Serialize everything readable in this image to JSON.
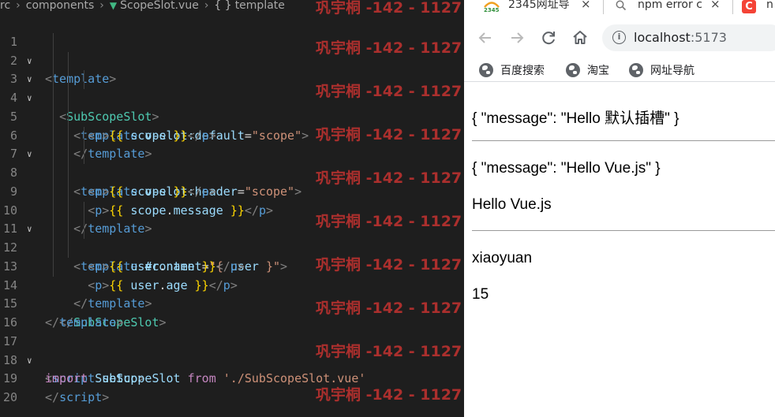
{
  "editor": {
    "breadcrumb": [
      "rc",
      "components",
      "ScopeSlot.vue",
      "template"
    ],
    "lines": [
      {
        "n": "1"
      },
      {
        "n": "2"
      },
      {
        "n": "3"
      },
      {
        "n": "4"
      },
      {
        "n": "5"
      },
      {
        "n": "6"
      },
      {
        "n": "7"
      },
      {
        "n": "8"
      },
      {
        "n": "9"
      },
      {
        "n": "10"
      },
      {
        "n": "11"
      },
      {
        "n": "12"
      },
      {
        "n": "13"
      },
      {
        "n": "14"
      },
      {
        "n": "15"
      },
      {
        "n": "16"
      },
      {
        "n": "17"
      },
      {
        "n": "18"
      },
      {
        "n": "19"
      },
      {
        "n": "20"
      }
    ],
    "code": {
      "l1": {
        "tag": "template"
      },
      "l2": {
        "tag": "SubScopeSlot"
      },
      "l3": {
        "tag": "template",
        "attr": "v-slot:default",
        "val": "\"scope\""
      },
      "l4": {
        "tag": "p",
        "expr": "scope"
      },
      "l5": {
        "tag": "template"
      },
      "l6": {
        "tag": "template",
        "attr": "v-slot:header",
        "val": "\"scope\""
      },
      "l7": {
        "tag": "p",
        "expr": "scope"
      },
      "l8": {
        "tag": "p",
        "obj": "scope",
        "prop": "message"
      },
      "l9": {
        "tag": "template"
      },
      "l10": {
        "tag": "template",
        "attr": "#content",
        "val_open": "\"{ ",
        "val_var": "user",
        "val_close": " }\""
      },
      "l11": {
        "tag": "p",
        "obj": "user",
        "prop": "name"
      },
      "l12": {
        "tag": "p",
        "obj": "user",
        "prop": "age"
      },
      "l13": {
        "tag": "template"
      },
      "l14": {
        "tag": "SubScopeSlot"
      },
      "l15": {
        "tag": "template"
      },
      "l17": {
        "tag": "script",
        "attr": "setup"
      },
      "l18": {
        "kw1": "import",
        "ident": "SubScopeSlot",
        "kw2": "from",
        "str": "'./SubScopeSlot.vue'"
      },
      "l19": {
        "tag": "script"
      }
    },
    "watermark": "巩宇桐 -142 - 1127",
    "colors": {
      "background": "#1e1e1e",
      "tag": "#569cd6",
      "attr": "#9cdcfe",
      "string": "#ce9178",
      "brace": "#ffd700",
      "keyword": "#c586c0",
      "class": "#4ec9b0",
      "watermark": "#b8312f"
    }
  },
  "browser": {
    "tabs": [
      {
        "title": "2345网址导",
        "icon": "2345-favicon-icon"
      },
      {
        "title": "npm error c",
        "icon": "search-icon"
      },
      {
        "title": "n",
        "icon": "c-favicon-icon"
      }
    ],
    "favicon_2345_text": "2345",
    "favicon_c_text": "C",
    "close_glyph": "×",
    "address": {
      "host": "localhost",
      "port": ":5173",
      "icon": "info-icon"
    },
    "bookmarks": [
      {
        "label": "百度搜索",
        "icon": "globe-icon"
      },
      {
        "label": "淘宝",
        "icon": "globe-icon"
      },
      {
        "label": "网址导航",
        "icon": "globe-icon"
      }
    ],
    "page": {
      "default_slot": "{ \"message\": \"Hello 默认插槽\" }",
      "header_scope": "{ \"message\": \"Hello Vue.js\" }",
      "header_message": "Hello Vue.js",
      "user_name": "xiaoyuan",
      "user_age": "15"
    }
  }
}
